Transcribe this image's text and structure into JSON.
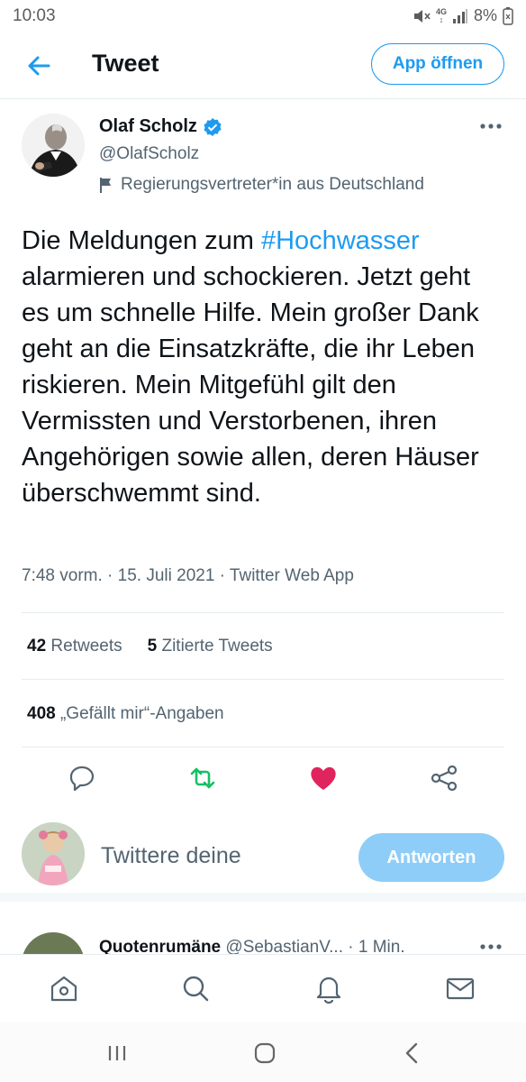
{
  "status_bar": {
    "time": "10:03",
    "network": "4G",
    "battery": "8%"
  },
  "header": {
    "title": "Tweet",
    "open_app_label": "App öffnen",
    "back_icon": "arrow-left-icon"
  },
  "author": {
    "name": "Olaf Scholz",
    "handle": "@OlafScholz",
    "label": "Regierungsvertreter*in aus Deutschland",
    "verified": true
  },
  "tweet": {
    "text_before": "Die Meldungen zum ",
    "hashtag": "#Hochwasser",
    "text_after": " alarmieren und schockieren. Jetzt geht es um schnelle Hilfe. Mein großer Dank geht an die Einsatzkräfte, die ihr Leben riskieren. Mein Mitgefühl gilt den Vermissten und Verstorbenen, ihren Angehörigen sowie allen, deren Häuser überschwemmt sind.",
    "meta": "7:48 vorm. · 15. Juli 2021 · Twitter Web App"
  },
  "stats": {
    "retweets_count": "42",
    "retweets_label": "Retweets",
    "quotes_count": "5",
    "quotes_label": "Zitierte Tweets",
    "likes_count": "408",
    "likes_label": "„Gefällt mir“-Angaben"
  },
  "actions": {
    "reply_icon": "comment-icon",
    "retweet_icon": "retweet-icon",
    "like_icon": "heart-icon",
    "share_icon": "share-icon",
    "colors": {
      "retweet": "#17bf63",
      "like": "#e0245e",
      "neutral": "#536471"
    }
  },
  "reply_box": {
    "placeholder": "Twittere deine",
    "button_label": "Antworten"
  },
  "next_tweet": {
    "name": "Quotenrumäne",
    "handle": "@SebastianV...",
    "time": "· 1 Min."
  },
  "bottom_nav": [
    "home-icon",
    "search-icon",
    "bell-icon",
    "mail-icon"
  ],
  "colors": {
    "accent": "#1d9bf0",
    "text": "#0f1419",
    "secondary": "#536471"
  }
}
